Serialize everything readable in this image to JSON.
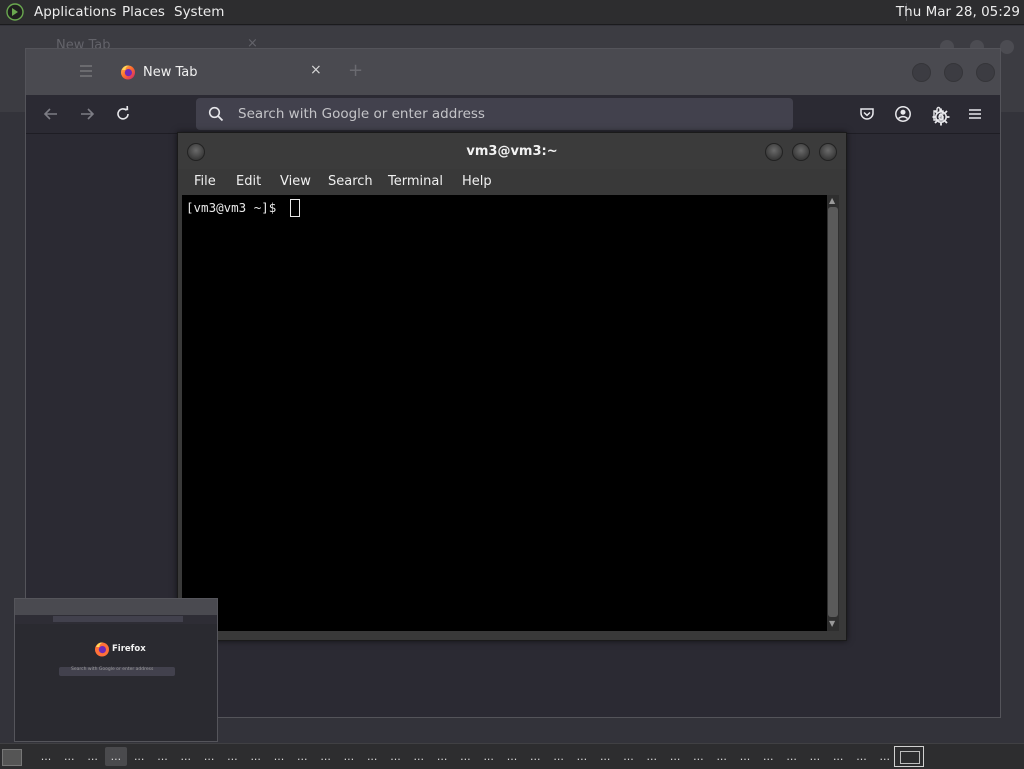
{
  "top_panel": {
    "menus": [
      "Applications",
      "Places",
      "System"
    ],
    "clock": "Thu Mar 28, 05:29"
  },
  "ghost_window": {
    "tab_label": "New Tab",
    "close_glyph": "×"
  },
  "browser": {
    "tab_label": "New Tab",
    "tab_close_glyph": "×",
    "new_tab_glyph": "+",
    "url_placeholder": "Search with Google or enter address",
    "url_value": "",
    "icons": [
      "back-icon",
      "forward-icon",
      "reload-icon",
      "search-icon",
      "pocket-icon",
      "account-icon",
      "extensions-icon",
      "menu-icon",
      "settings-gear-icon"
    ]
  },
  "terminal": {
    "title": "vm3@vm3:~",
    "menus": [
      "File",
      "Edit",
      "View",
      "Search",
      "Terminal",
      "Help"
    ],
    "prompt": "[vm3@vm3 ~]$"
  },
  "preview": {
    "brand": "Firefox",
    "search_text": "Search with Google or enter address"
  },
  "taskbar": {
    "item_label": "...",
    "item_count": 37
  },
  "colors": {
    "panel": "#2d2d2f",
    "desktop": "#33333a",
    "firefox_bg": "#2b2a33",
    "terminal_bg": "#000000"
  }
}
